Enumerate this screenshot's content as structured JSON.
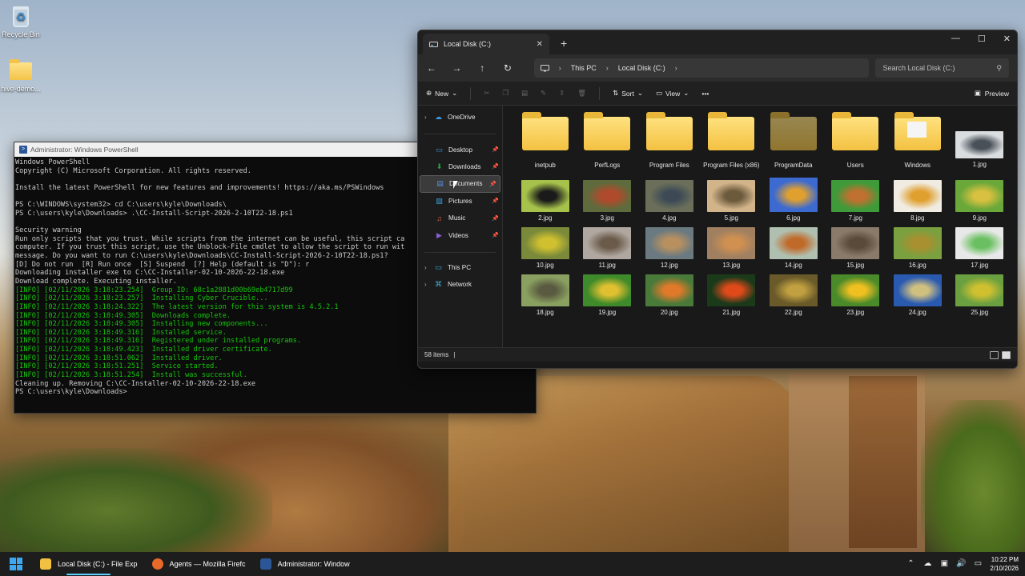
{
  "desktop": {
    "icons": [
      {
        "label": "Recycle Bin"
      },
      {
        "label": "hive-demo..."
      }
    ]
  },
  "powershell": {
    "title": "Administrator: Windows PowerShell",
    "lines": [
      {
        "text": "Windows PowerShell",
        "kind": "plain"
      },
      {
        "text": "Copyright (C) Microsoft Corporation. All rights reserved.",
        "kind": "plain"
      },
      {
        "text": "",
        "kind": "plain"
      },
      {
        "text": "Install the latest PowerShell for new features and improvements! https://aka.ms/PSWindows",
        "kind": "plain"
      },
      {
        "text": "",
        "kind": "plain"
      },
      {
        "text": "PS C:\\WINDOWS\\system32> cd C:\\users\\kyle\\Downloads\\",
        "kind": "cmd"
      },
      {
        "text": "PS C:\\users\\kyle\\Downloads> .\\CC-Install-Script-2026-2-10T22-18.ps1",
        "kind": "cmd"
      },
      {
        "text": "",
        "kind": "plain"
      },
      {
        "text": "Security warning",
        "kind": "plain"
      },
      {
        "text": "Run only scripts that you trust. While scripts from the internet can be useful, this script ca",
        "kind": "plain"
      },
      {
        "text": "computer. If you trust this script, use the Unblock-File cmdlet to allow the script to run wit",
        "kind": "plain"
      },
      {
        "text": "message. Do you want to run C:\\users\\kyle\\Downloads\\CC-Install-Script-2026-2-10T22-18.ps1?",
        "kind": "plain"
      },
      {
        "text": "[D] Do not run  [R] Run once  [S] Suspend  [?] Help (default is \"D\"): r",
        "kind": "plain"
      },
      {
        "text": "Downloading installer exe to C:\\CC-Installer-02-10-2026-22-18.exe",
        "kind": "plain"
      },
      {
        "text": "Download complete. Executing installer.",
        "kind": "plain"
      },
      {
        "text": "[INFO] [02/11/2026 3:18:23.254]  Group ID: 68c1a2881d00b69eb4717d99",
        "kind": "info"
      },
      {
        "text": "[INFO] [02/11/2026 3:18:23.257]  Installing Cyber Crucible...",
        "kind": "info"
      },
      {
        "text": "[INFO] [02/11/2026 3:18:24.322]  The latest version for this system is 4.5.2.1",
        "kind": "info"
      },
      {
        "text": "[INFO] [02/11/2026 3:18:49.305]  Downloads complete.",
        "kind": "info"
      },
      {
        "text": "[INFO] [02/11/2026 3:18:49.305]  Installing new components...",
        "kind": "info"
      },
      {
        "text": "[INFO] [02/11/2026 3:18:49.316]  Installed service.",
        "kind": "info"
      },
      {
        "text": "[INFO] [02/11/2026 3:18:49.316]  Registered under installed programs.",
        "kind": "info"
      },
      {
        "text": "[INFO] [02/11/2026 3:18:49.423]  Installed driver certificate.",
        "kind": "info"
      },
      {
        "text": "[INFO] [02/11/2026 3:18:51.062]  Installed driver.",
        "kind": "info"
      },
      {
        "text": "[INFO] [02/11/2026 3:18:51.251]  Service started.",
        "kind": "info"
      },
      {
        "text": "[INFO] [02/11/2026 3:18:51.254]  Install was successful.",
        "kind": "info"
      },
      {
        "text": "Cleaning up. Removing C:\\CC-Installer-02-10-2026-22-18.exe",
        "kind": "plain"
      },
      {
        "text": "PS C:\\users\\kyle\\Downloads>",
        "kind": "plain"
      }
    ]
  },
  "explorer": {
    "tab_title": "Local Disk (C:)",
    "breadcrumb": [
      "This PC",
      "Local Disk (C:)"
    ],
    "search_placeholder": "Search Local Disk (C:)",
    "toolbar": {
      "new_label": "New",
      "sort_label": "Sort",
      "view_label": "View",
      "more_label": "•••",
      "preview_label": "Preview"
    },
    "sidebar": [
      {
        "label": "OneDrive",
        "type": "root",
        "icon": "cloud-icon",
        "color": "#3a96dd"
      },
      {
        "label": "Desktop",
        "type": "pinned",
        "icon": "desktop-icon",
        "color": "#3a96dd"
      },
      {
        "label": "Downloads",
        "type": "pinned",
        "icon": "download-icon",
        "color": "#2ea043"
      },
      {
        "label": "Documents",
        "type": "pinned",
        "icon": "document-icon",
        "color": "#5b8fd6",
        "selected": true
      },
      {
        "label": "Pictures",
        "type": "pinned",
        "icon": "pictures-icon",
        "color": "#3aa0e0"
      },
      {
        "label": "Music",
        "type": "pinned",
        "icon": "music-icon",
        "color": "#e06040"
      },
      {
        "label": "Videos",
        "type": "pinned",
        "icon": "video-icon",
        "color": "#8a5fd6"
      },
      {
        "label": "This PC",
        "type": "root",
        "icon": "computer-icon",
        "color": "#3ab0d6"
      },
      {
        "label": "Network",
        "type": "root",
        "icon": "network-icon",
        "color": "#3ab0d6"
      }
    ],
    "folders": [
      {
        "label": "inetpub"
      },
      {
        "label": "PerfLogs"
      },
      {
        "label": "Program Files"
      },
      {
        "label": "Program Files (x86)"
      },
      {
        "label": "ProgramData",
        "faded": true
      },
      {
        "label": "Users"
      },
      {
        "label": "Windows",
        "paper": true
      }
    ],
    "images": [
      {
        "label": "1.jpg",
        "c1": "#d9dde0",
        "c2": "#4a5058"
      },
      {
        "label": "2.jpg",
        "c1": "#a6c24a",
        "c2": "#1a1a1a"
      },
      {
        "label": "3.jpg",
        "c1": "#5f6b3c",
        "c2": "#b04a2c"
      },
      {
        "label": "4.jpg",
        "c1": "#6b6f5a",
        "c2": "#3d4a55"
      },
      {
        "label": "5.jpg",
        "c1": "#d2b48a",
        "c2": "#6b5a3c"
      },
      {
        "label": "6.jpg",
        "c1": "#3c6ad0",
        "c2": "#e0a030"
      },
      {
        "label": "7.jpg",
        "c1": "#3f9a3a",
        "c2": "#c07030"
      },
      {
        "label": "8.jpg",
        "c1": "#f0ece2",
        "c2": "#e0a030"
      },
      {
        "label": "9.jpg",
        "c1": "#6aa83a",
        "c2": "#d8c040"
      },
      {
        "label": "10.jpg",
        "c1": "#7a8a3a",
        "c2": "#d0c030"
      },
      {
        "label": "11.jpg",
        "c1": "#b0a8a0",
        "c2": "#6a5a4a"
      },
      {
        "label": "12.jpg",
        "c1": "#6a7a80",
        "c2": "#b89060"
      },
      {
        "label": "13.jpg",
        "c1": "#a08060",
        "c2": "#d09050"
      },
      {
        "label": "14.jpg",
        "c1": "#b0c0b0",
        "c2": "#c06a2a"
      },
      {
        "label": "15.jpg",
        "c1": "#8a7a6a",
        "c2": "#5a4a3a"
      },
      {
        "label": "16.jpg",
        "c1": "#7aa040",
        "c2": "#a89030"
      },
      {
        "label": "17.jpg",
        "c1": "#e8e8e8",
        "c2": "#6ac060"
      },
      {
        "label": "18.jpg",
        "c1": "#8aa060",
        "c2": "#5a5a40"
      },
      {
        "label": "19.jpg",
        "c1": "#3f8a2a",
        "c2": "#e0c030"
      },
      {
        "label": "20.jpg",
        "c1": "#4a7a3a",
        "c2": "#e07a2a"
      },
      {
        "label": "21.jpg",
        "c1": "#1a3a1a",
        "c2": "#e04a1a"
      },
      {
        "label": "22.jpg",
        "c1": "#6a5a2a",
        "c2": "#c0a040"
      },
      {
        "label": "23.jpg",
        "c1": "#4a8a2a",
        "c2": "#f0c020"
      },
      {
        "label": "24.jpg",
        "c1": "#2a5ab0",
        "c2": "#d0c080"
      },
      {
        "label": "25.jpg",
        "c1": "#6aa040",
        "c2": "#d0c030"
      }
    ],
    "status_text": "58 items"
  },
  "taskbar": {
    "items": [
      {
        "label": "Local Disk (C:) - File Exp",
        "icon": "file-explorer-icon",
        "color": "#f3c142",
        "active": true
      },
      {
        "label": "Agents — Mozilla Firefc",
        "icon": "firefox-icon",
        "color": "#e8692a",
        "active": false
      },
      {
        "label": "Administrator: Window",
        "icon": "powershell-icon",
        "color": "#2b5797",
        "active": false
      }
    ],
    "time": "10:22 PM",
    "date": "2/10/2026"
  }
}
